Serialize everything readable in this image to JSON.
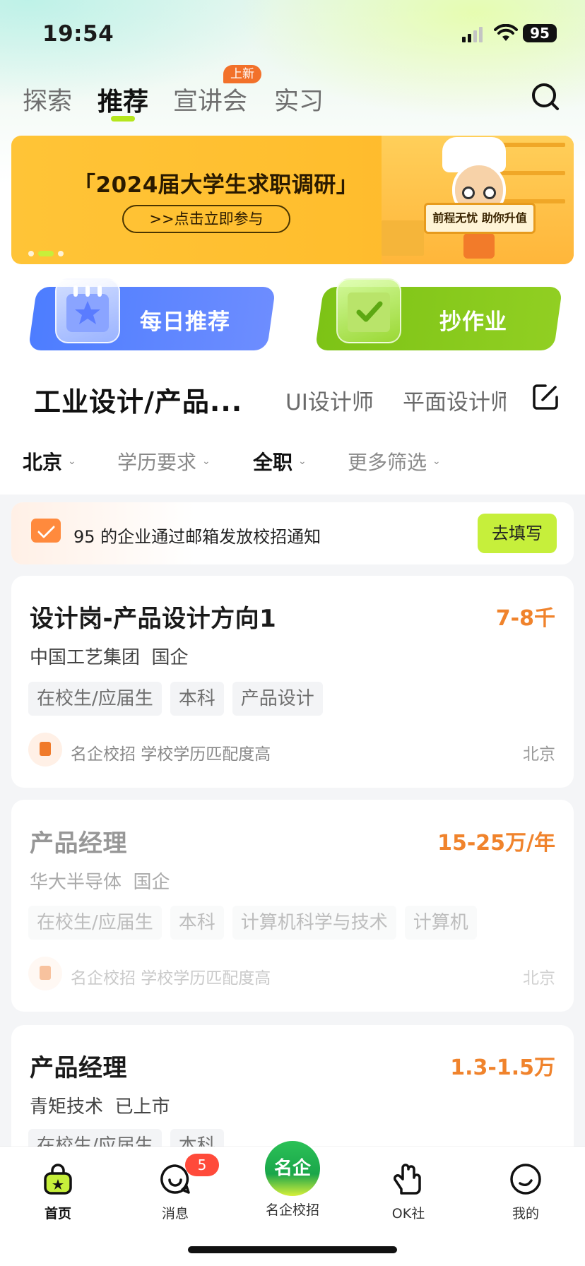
{
  "status": {
    "time": "19:54",
    "battery": "95"
  },
  "tabs": [
    {
      "label": "探索"
    },
    {
      "label": "推荐"
    },
    {
      "label": "宣讲会",
      "badge": "上新"
    },
    {
      "label": "实习"
    }
  ],
  "banner": {
    "title": "「2024届大学生求职调研」",
    "button": ">>点击立即参与",
    "sign": "前程无忧 助你升值"
  },
  "features": {
    "daily": "每日推荐",
    "homework": "抄作业"
  },
  "categories": {
    "selected": "工业设计/产品...",
    "items": [
      "UI设计师",
      "平面设计师"
    ]
  },
  "filters": [
    {
      "label": "北京"
    },
    {
      "label": "学历要求"
    },
    {
      "label": "全职"
    },
    {
      "label": "更多筛选"
    }
  ],
  "notice": {
    "text": "95 的企业通过邮箱发放校招通知",
    "button": "去填写"
  },
  "jobs": [
    {
      "title": "设计岗-产品设计方向1",
      "salary": "7-8千",
      "company": "中国工艺集团",
      "company_type": "国企",
      "tags": [
        "在校生/应届生",
        "本科",
        "产品设计"
      ],
      "meta": "名企校招 学校学历匹配度高",
      "city": "北京"
    },
    {
      "title": "产品经理",
      "salary": "15-25万/年",
      "company": "华大半导体",
      "company_type": "国企",
      "tags": [
        "在校生/应届生",
        "本科",
        "计算机科学与技术",
        "计算机"
      ],
      "meta": "名企校招 学校学历匹配度高",
      "city": "北京"
    },
    {
      "title": "产品经理",
      "salary": "1.3-1.5万",
      "company": "青矩技术",
      "company_type": "已上市",
      "tags": [
        "在校生/应届生",
        "本科"
      ]
    }
  ],
  "nav": {
    "home": "首页",
    "messages": "消息",
    "messages_badge": "5",
    "center_logo": "名企",
    "famous": "名企校招",
    "ok": "OK社",
    "mine": "我的"
  },
  "colors": {
    "accent_green": "#b5e61d",
    "salary_orange": "#f0832c",
    "banner_yellow": "#ffc437",
    "daily_blue": "#4d7dff",
    "homework_green": "#7dc316"
  }
}
